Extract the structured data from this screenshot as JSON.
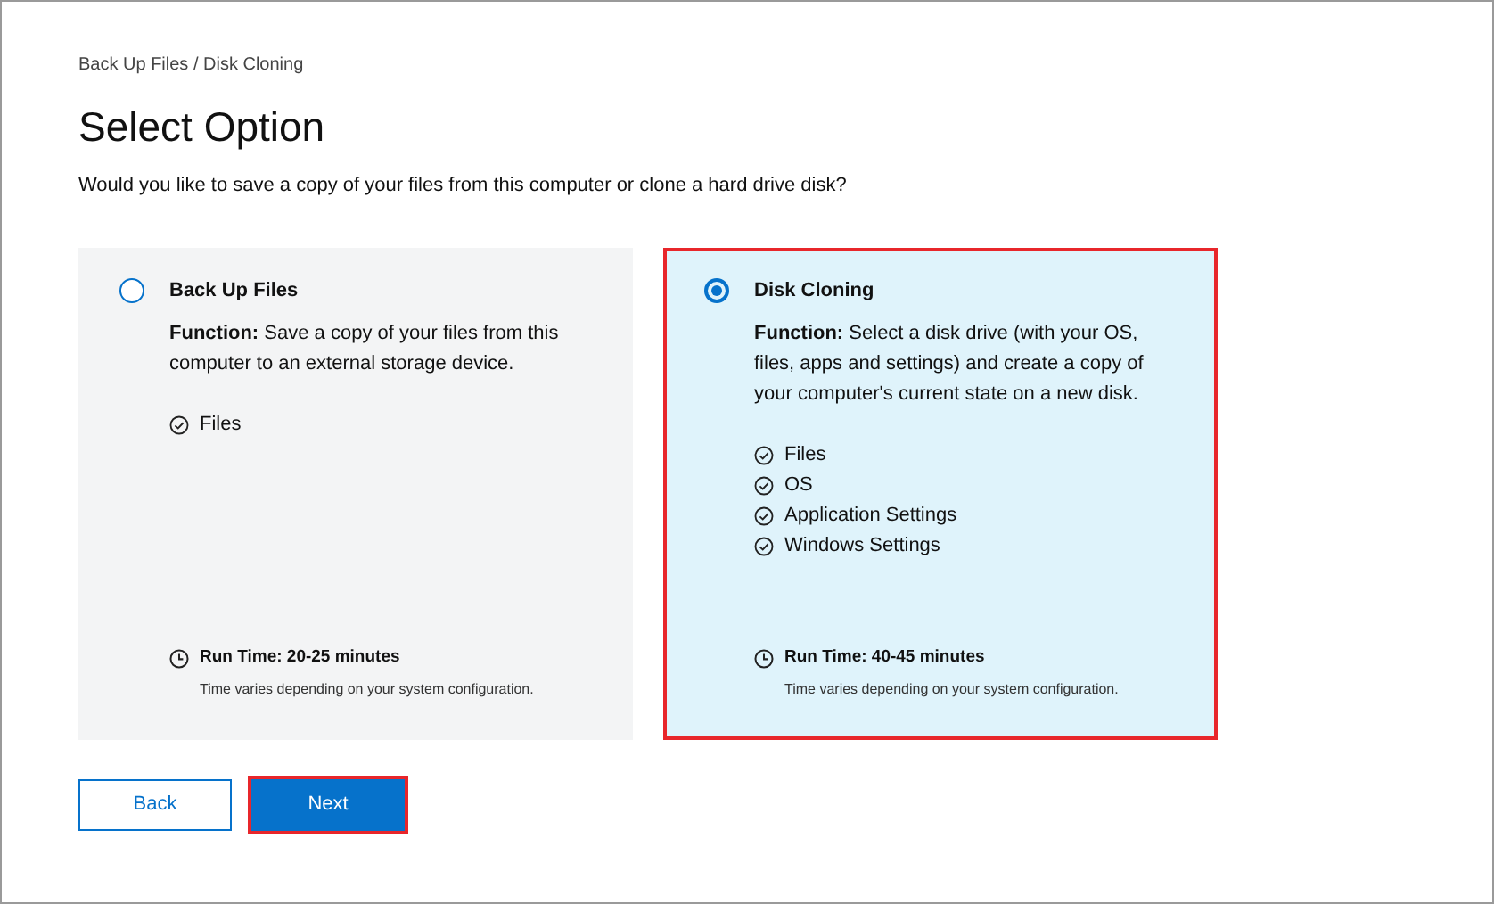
{
  "breadcrumb": "Back Up Files / Disk Cloning",
  "title": "Select Option",
  "subtitle": "Would you like to save a copy of your files from this computer or clone a hard drive disk?",
  "options": [
    {
      "title": "Back Up Files",
      "selected": false,
      "highlighted": false,
      "function": "**Function:** Save a copy of your files from this computer to an external storage device.",
      "items": [
        "Files"
      ],
      "run_time": "Run Time: 20-25 minutes",
      "note": "Time varies depending on your system configuration."
    },
    {
      "title": "Disk Cloning",
      "selected": true,
      "highlighted": true,
      "function": "**Function:** Select a disk drive (with your OS, files, apps and settings) and create a copy of your computer's current state on a new disk.",
      "items": [
        "Files",
        "OS",
        "Application Settings",
        "Windows Settings"
      ],
      "run_time": "Run Time: 40-45 minutes",
      "note": "Time varies depending on your system configuration."
    }
  ],
  "buttons": [
    {
      "label": "Back",
      "kind": "secondary",
      "highlighted": false
    },
    {
      "label": "Next",
      "kind": "primary",
      "highlighted": true
    }
  ]
}
